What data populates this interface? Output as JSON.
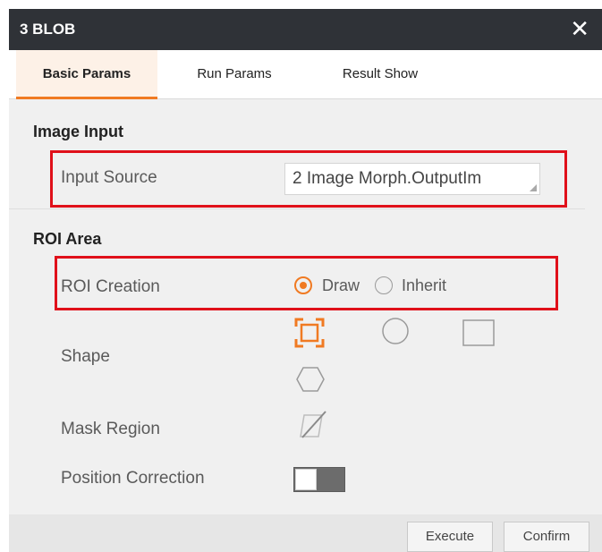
{
  "window": {
    "title": "3 BLOB",
    "close_icon": "close-icon"
  },
  "tabs": [
    {
      "label": "Basic Params",
      "active": true
    },
    {
      "label": "Run Params",
      "active": false
    },
    {
      "label": "Result Show",
      "active": false
    }
  ],
  "image_input": {
    "section_title": "Image Input",
    "input_source_label": "Input Source",
    "input_source_value": "2 Image Morph.OutputIm"
  },
  "roi_area": {
    "section_title": "ROI Area",
    "roi_creation_label": "ROI Creation",
    "options": [
      {
        "label": "Draw",
        "selected": true
      },
      {
        "label": "Inherit",
        "selected": false
      }
    ],
    "shape_label": "Shape",
    "shapes": [
      "fullscreen-roi-icon",
      "circle-icon",
      "rectangle-icon",
      "polygon-icon"
    ],
    "selected_shape": "fullscreen-roi-icon",
    "mask_region_label": "Mask Region",
    "mask_icon": "mask-region-icon",
    "position_correction_label": "Position Correction",
    "position_correction_enabled": false
  },
  "footer": {
    "execute_label": "Execute",
    "confirm_label": "Confirm"
  },
  "colors": {
    "accent": "#f07a22",
    "titlebar": "#2f3237",
    "highlight_box": "#e0101a"
  }
}
